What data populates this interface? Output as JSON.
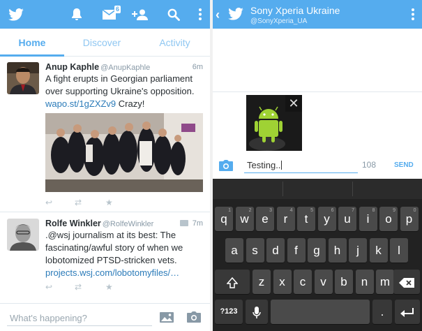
{
  "left": {
    "topbar": {
      "dm_badge": "6"
    },
    "tabs": [
      {
        "label": "Home",
        "active": true
      },
      {
        "label": "Discover",
        "active": false
      },
      {
        "label": "Activity",
        "active": false
      }
    ],
    "tweets": [
      {
        "name": "Anup Kaphle",
        "handle": "@AnupKaphle",
        "time": "6m",
        "text_lines": [
          "A fight erupts in Georgian parliament",
          "over supporting Ukraine's opposition."
        ],
        "link": "wapo.st/1gZXZv9",
        "link_suffix": " Crazy!"
      },
      {
        "name": "Rolfe Winkler",
        "handle": "@RolfeWinkler",
        "time": "7m",
        "text_lines": [
          ".@wsj journalism at its best: The",
          "fascinating/awful story of when we",
          "lobotomized PTSD-stricken vets."
        ],
        "link": "projects.wsj.com/lobotomyfiles/…"
      }
    ],
    "compose": {
      "placeholder": "What's happening?"
    }
  },
  "right": {
    "title": "Sony Xperia Ukraine",
    "subtitle": "@SonyXperia_UA",
    "dm_input": "Testing..",
    "char_count": "108",
    "send_label": "SEND",
    "keyboard": {
      "row1": [
        {
          "k": "q",
          "a": "1"
        },
        {
          "k": "w",
          "a": "2"
        },
        {
          "k": "e",
          "a": "3"
        },
        {
          "k": "r",
          "a": "4"
        },
        {
          "k": "t",
          "a": "5"
        },
        {
          "k": "y",
          "a": "6"
        },
        {
          "k": "u",
          "a": "7"
        },
        {
          "k": "i",
          "a": "8"
        },
        {
          "k": "o",
          "a": "9"
        },
        {
          "k": "p",
          "a": "0"
        }
      ],
      "row2": [
        "a",
        "s",
        "d",
        "f",
        "g",
        "h",
        "j",
        "k",
        "l"
      ],
      "row3": [
        "z",
        "x",
        "c",
        "v",
        "b",
        "n",
        "m"
      ],
      "sym_label": "?123",
      "period": "."
    }
  },
  "colors": {
    "accent": "#55acee",
    "link": "#2b7bb9",
    "keyboard_bg": "#222222"
  }
}
